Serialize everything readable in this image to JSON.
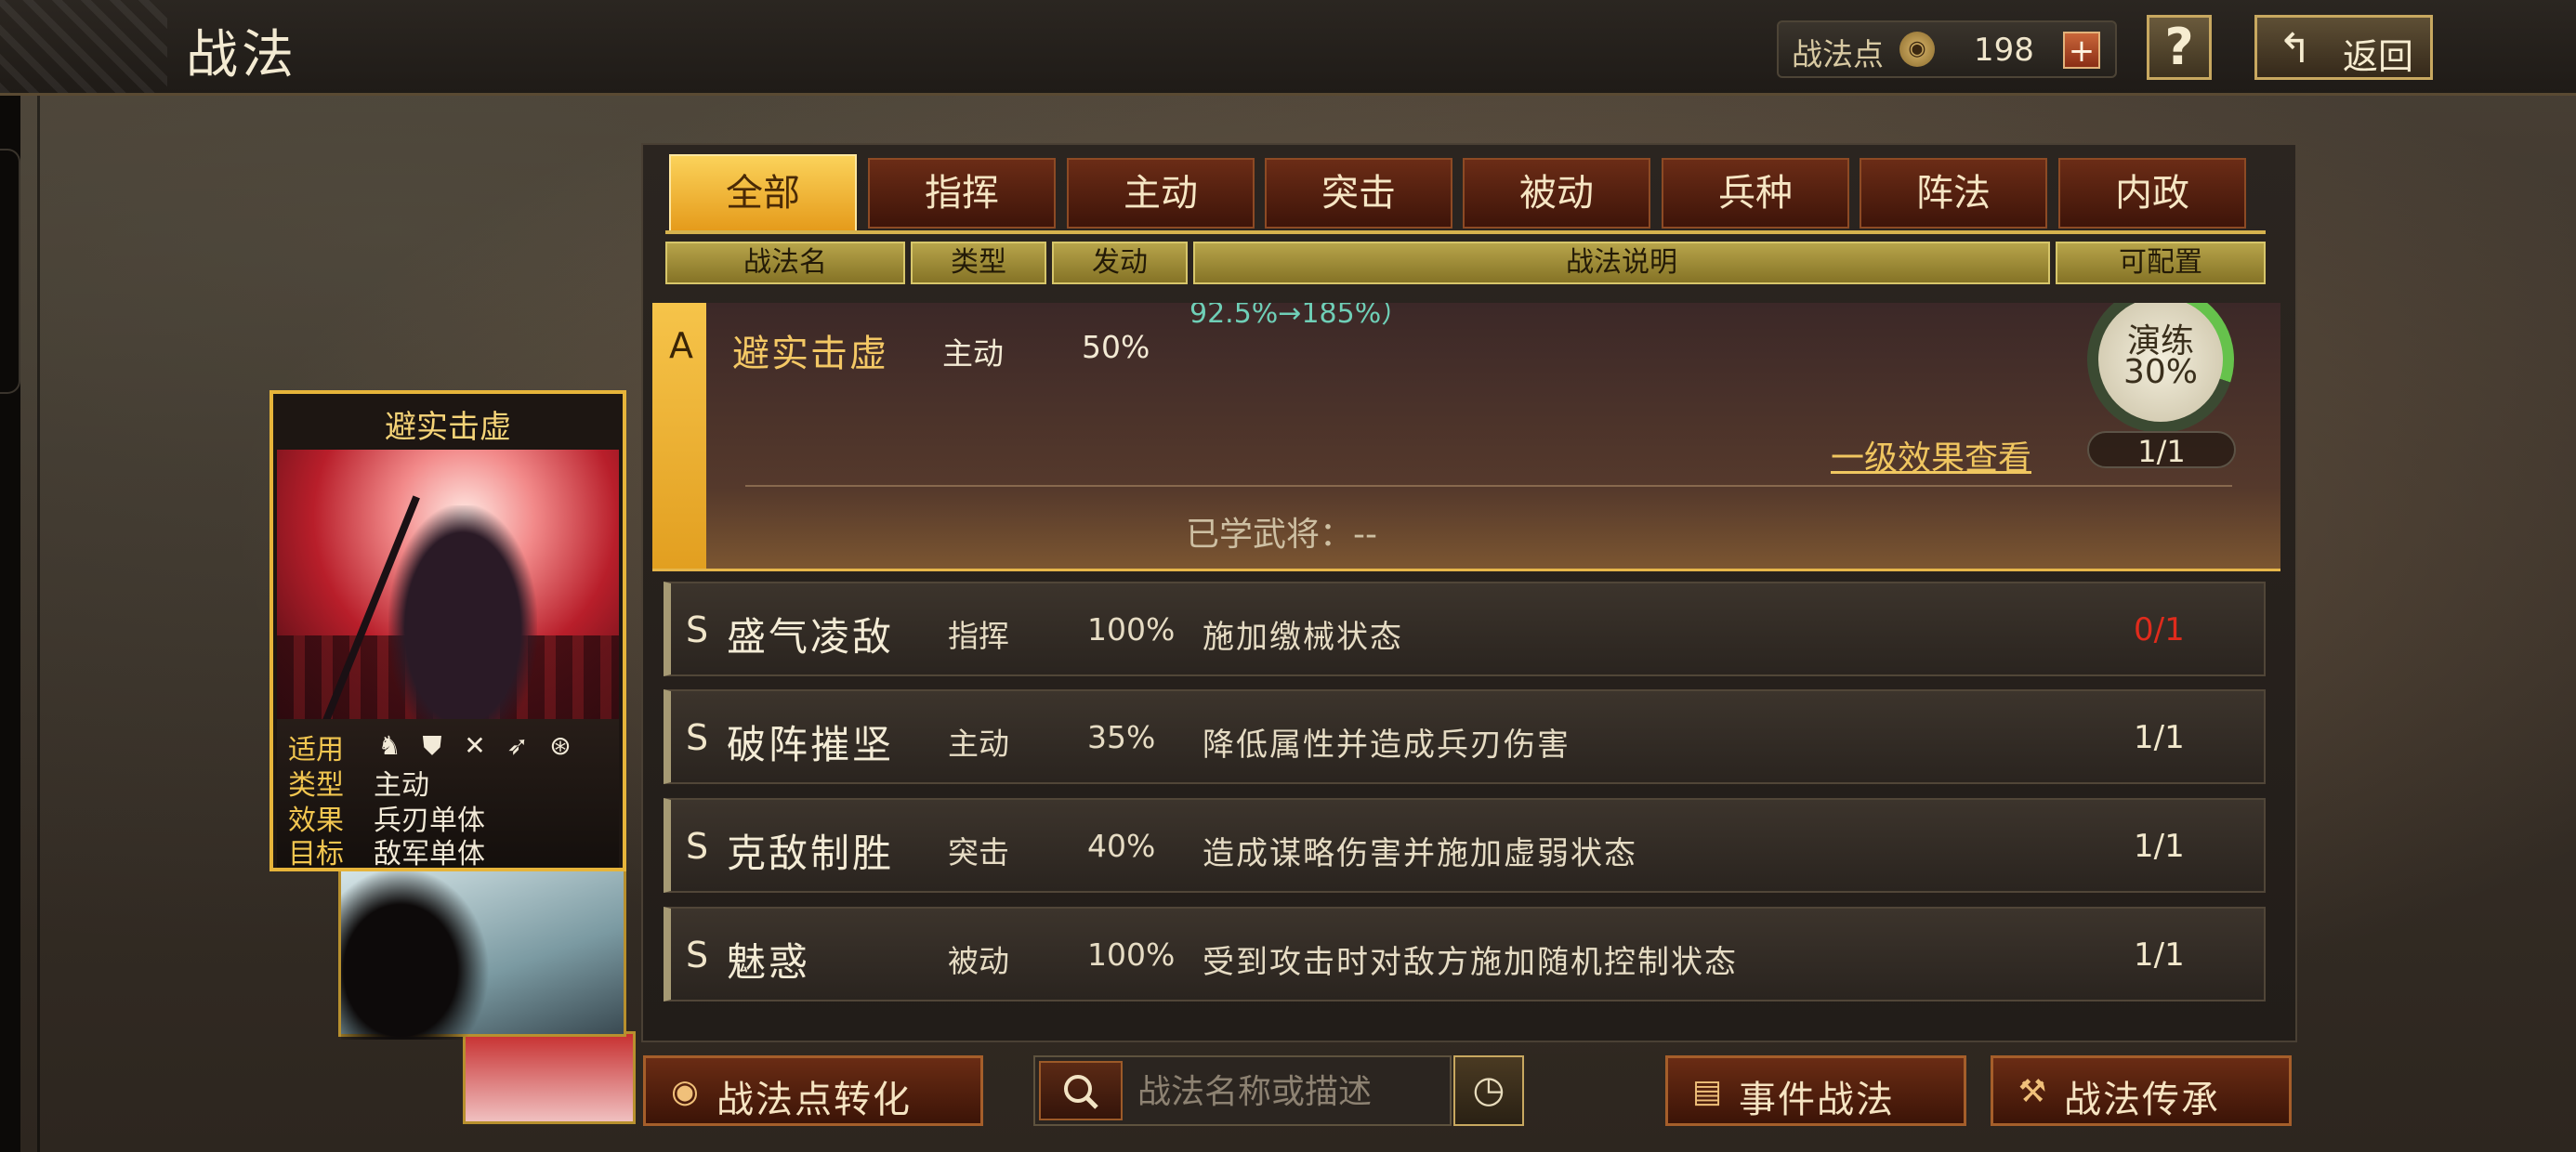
{
  "window": {
    "title": "战法"
  },
  "header": {
    "points_label": "战法点",
    "points_value": "198",
    "plus_label": "+",
    "help_label": "?",
    "back_label": "返回"
  },
  "tabs": [
    {
      "label": "全部",
      "active": true
    },
    {
      "label": "指挥",
      "active": false
    },
    {
      "label": "主动",
      "active": false
    },
    {
      "label": "突击",
      "active": false
    },
    {
      "label": "被动",
      "active": false
    },
    {
      "label": "兵种",
      "active": false
    },
    {
      "label": "阵法",
      "active": false
    },
    {
      "label": "内政",
      "active": false
    }
  ],
  "columns": [
    "战法名",
    "类型",
    "发动",
    "战法说明",
    "可配置"
  ],
  "selected": {
    "grade": "A",
    "name": "避实击虚",
    "type": "主动",
    "rate": "50%",
    "desc_partial": "92.5%→185%）",
    "train_label": "演练",
    "train_pct": "30%",
    "train_progress": 0.3,
    "level_link": "一级效果查看",
    "count": "1/1",
    "learned": "已学武将：--"
  },
  "skills": [
    {
      "grade": "S",
      "name": "盛气凌敌",
      "type": "指挥",
      "rate": "100%",
      "desc": "施加缴械状态",
      "count": "0/1",
      "count_color": "#e02b1c"
    },
    {
      "grade": "S",
      "name": "破阵摧坚",
      "type": "主动",
      "rate": "35%",
      "desc": "降低属性并造成兵刃伤害",
      "count": "1/1"
    },
    {
      "grade": "S",
      "name": "克敌制胜",
      "type": "突击",
      "rate": "40%",
      "desc": "造成谋略伤害并施加虚弱状态",
      "count": "1/1"
    },
    {
      "grade": "S",
      "name": "魅惑",
      "type": "被动",
      "rate": "100%",
      "desc": "受到攻击时对敌方施加随机控制状态",
      "count": "1/1"
    }
  ],
  "card": {
    "title": "避实击虚",
    "applicable_label": "适用",
    "type_label": "类型",
    "type_value": "主动",
    "effect_label": "效果",
    "effect_value": "兵刃单体",
    "target_label": "目标",
    "target_value": "敌军单体",
    "unit_icons": [
      "cavalry-icon",
      "shield-icon",
      "bow-icon",
      "spear-icon",
      "chariot-icon"
    ]
  },
  "bottom": {
    "convert_label": "战法点转化",
    "search_placeholder": "战法名称或描述",
    "event_label": "事件战法",
    "inherit_label": "战法传承"
  }
}
